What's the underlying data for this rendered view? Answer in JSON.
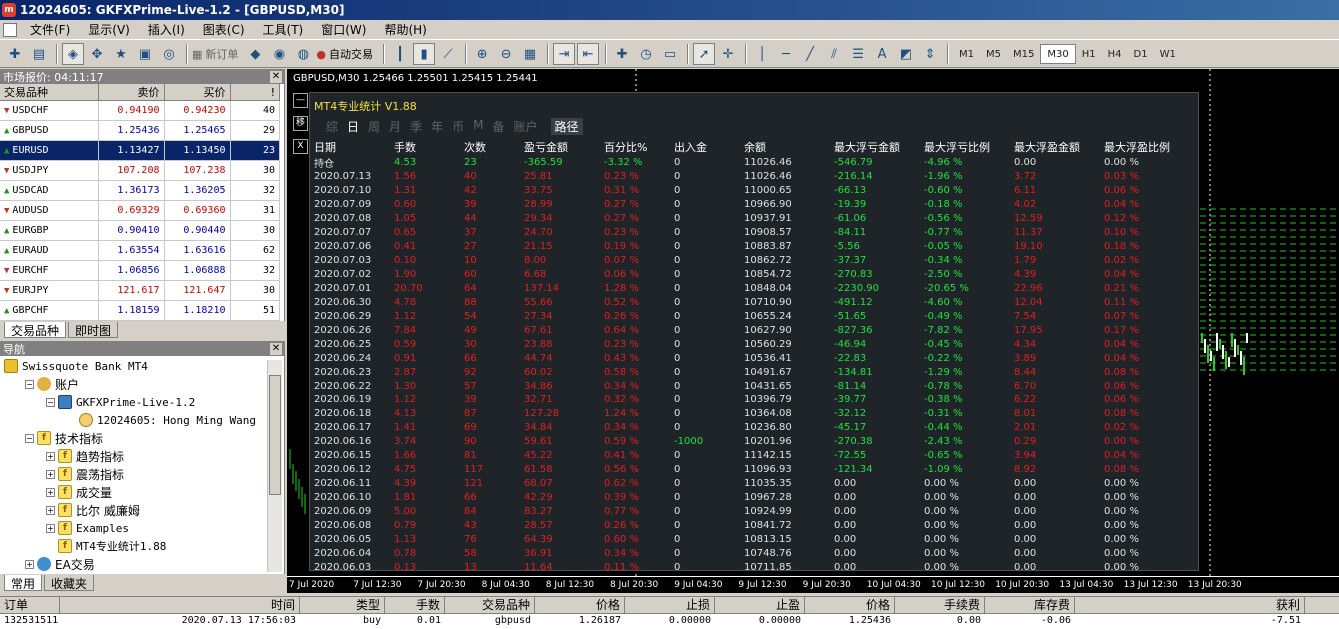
{
  "window": {
    "title": "12024605: GKFXPrime-Live-1.2 - [GBPUSD,M30]"
  },
  "menu": [
    "文件(F)",
    "显示(V)",
    "插入(I)",
    "图表(C)",
    "工具(T)",
    "窗口(W)",
    "帮助(H)"
  ],
  "toolbar": {
    "new_order_label": "新订单",
    "auto_trade_label": "自动交易",
    "timeframes": [
      "M1",
      "M5",
      "M15",
      "M30",
      "H1",
      "H4",
      "D1",
      "W1"
    ],
    "active_timeframe": "M30"
  },
  "market_watch": {
    "title": "市场报价: 04:11:17",
    "columns": [
      "交易品种",
      "卖价",
      "买价",
      "!"
    ],
    "rows": [
      {
        "symbol": "USDCHF",
        "bid": "0.94190",
        "ask": "0.94230",
        "spread": "40",
        "dir": "down",
        "color": "red"
      },
      {
        "symbol": "GBPUSD",
        "bid": "1.25436",
        "ask": "1.25465",
        "spread": "29",
        "dir": "up",
        "color": "blue"
      },
      {
        "symbol": "EURUSD",
        "bid": "1.13427",
        "ask": "1.13450",
        "spread": "23",
        "dir": "up",
        "color": "blue",
        "selected": true
      },
      {
        "symbol": "USDJPY",
        "bid": "107.208",
        "ask": "107.238",
        "spread": "30",
        "dir": "down",
        "color": "red"
      },
      {
        "symbol": "USDCAD",
        "bid": "1.36173",
        "ask": "1.36205",
        "spread": "32",
        "dir": "up",
        "color": "blue"
      },
      {
        "symbol": "AUDUSD",
        "bid": "0.69329",
        "ask": "0.69360",
        "spread": "31",
        "dir": "down",
        "color": "red"
      },
      {
        "symbol": "EURGBP",
        "bid": "0.90410",
        "ask": "0.90440",
        "spread": "30",
        "dir": "up",
        "color": "blue"
      },
      {
        "symbol": "EURAUD",
        "bid": "1.63554",
        "ask": "1.63616",
        "spread": "62",
        "dir": "up",
        "color": "blue"
      },
      {
        "symbol": "EURCHF",
        "bid": "1.06856",
        "ask": "1.06888",
        "spread": "32",
        "dir": "down",
        "color": "blue"
      },
      {
        "symbol": "EURJPY",
        "bid": "121.617",
        "ask": "121.647",
        "spread": "30",
        "dir": "down",
        "color": "red"
      },
      {
        "symbol": "GBPCHF",
        "bid": "1.18159",
        "ask": "1.18210",
        "spread": "51",
        "dir": "up",
        "color": "blue"
      }
    ],
    "tabs": [
      "交易品种",
      "即时图"
    ]
  },
  "navigator": {
    "title": "导航",
    "items": [
      {
        "label": "Swissquote Bank MT4",
        "level": 0,
        "icon": "folder",
        "mono": true
      },
      {
        "label": "账户",
        "level": 1,
        "icon": "acct",
        "expand": "-"
      },
      {
        "label": "GKFXPrime-Live-1.2",
        "level": 2,
        "icon": "server",
        "expand": "-",
        "mono": true
      },
      {
        "label": "12024605: Hong Ming  Wang",
        "level": 3,
        "icon": "user",
        "mono": true
      },
      {
        "label": "技术指标",
        "level": 1,
        "icon": "ind",
        "expand": "-"
      },
      {
        "label": "趋势指标",
        "level": 2,
        "icon": "ind",
        "expand": "+"
      },
      {
        "label": "震荡指标",
        "level": 2,
        "icon": "ind",
        "expand": "+"
      },
      {
        "label": "成交量",
        "level": 2,
        "icon": "ind",
        "expand": "+"
      },
      {
        "label": "比尔 威廉姆",
        "level": 2,
        "icon": "ind",
        "expand": "+"
      },
      {
        "label": "Examples",
        "level": 2,
        "icon": "ind",
        "expand": "+",
        "mono": true
      },
      {
        "label": "MT4专业统计1.88",
        "level": 2,
        "icon": "ind",
        "mono": true
      },
      {
        "label": "EA交易",
        "level": 1,
        "icon": "ea",
        "expand": "+"
      }
    ],
    "tabs": [
      "常用",
      "收藏夹"
    ]
  },
  "chart": {
    "info": "GBPUSD,M30  1.25466 1.25501 1.25415 1.25441",
    "time_labels": [
      "7 Jul 2020",
      "7 Jul 12:30",
      "7 Jul 20:30",
      "8 Jul 04:30",
      "8 Jul 12:30",
      "8 Jul 20:30",
      "9 Jul 04:30",
      "9 Jul 12:30",
      "9 Jul 20:30",
      "10 Jul 04:30",
      "10 Jul 12:30",
      "10 Jul 20:30",
      "13 Jul 04:30",
      "13 Jul 12:30",
      "13 Jul 20:30"
    ]
  },
  "stats": {
    "title": "MT4专业统计 V1.88",
    "side_buttons": [
      "—",
      "移",
      "X"
    ],
    "tabs": [
      "综",
      "日",
      "周",
      "月",
      "季",
      "年",
      "币",
      "M",
      "备",
      "账户"
    ],
    "active_tab": "日",
    "path_tab": "路径",
    "columns": [
      "日期",
      "手数",
      "次数",
      "盈亏金额",
      "百分比%",
      "出入金",
      "余额",
      "最大浮亏金额",
      "最大浮亏比例",
      "最大浮盈金额",
      "最大浮盈比例"
    ],
    "holding_row": {
      "date": "持仓",
      "lots": "4.53",
      "count": "23",
      "pnl": "-365.59",
      "pct": "-3.32 %",
      "flow": "0",
      "balance": "11026.46",
      "mdd": "-546.79",
      "mddp": "-4.96 %",
      "mfe": "0.00",
      "mfep": "0.00 %"
    },
    "rows": [
      {
        "date": "2020.07.13",
        "lots": "1.56",
        "count": "40",
        "pnl": "25.81",
        "pct": "0.23 %",
        "flow": "0",
        "balance": "11026.46",
        "mdd": "-216.14",
        "mddp": "-1.96 %",
        "mfe": "3.72",
        "mfep": "0.03 %"
      },
      {
        "date": "2020.07.10",
        "lots": "1.31",
        "count": "42",
        "pnl": "33.75",
        "pct": "0.31 %",
        "flow": "0",
        "balance": "11000.65",
        "mdd": "-66.13",
        "mddp": "-0.60 %",
        "mfe": "6.11",
        "mfep": "0.06 %"
      },
      {
        "date": "2020.07.09",
        "lots": "0.60",
        "count": "39",
        "pnl": "28.99",
        "pct": "0.27 %",
        "flow": "0",
        "balance": "10966.90",
        "mdd": "-19.39",
        "mddp": "-0.18 %",
        "mfe": "4.02",
        "mfep": "0.04 %"
      },
      {
        "date": "2020.07.08",
        "lots": "1.05",
        "count": "44",
        "pnl": "29.34",
        "pct": "0.27 %",
        "flow": "0",
        "balance": "10937.91",
        "mdd": "-61.06",
        "mddp": "-0.56 %",
        "mfe": "12.59",
        "mfep": "0.12 %"
      },
      {
        "date": "2020.07.07",
        "lots": "0.65",
        "count": "37",
        "pnl": "24.70",
        "pct": "0.23 %",
        "flow": "0",
        "balance": "10908.57",
        "mdd": "-84.11",
        "mddp": "-0.77 %",
        "mfe": "11.37",
        "mfep": "0.10 %"
      },
      {
        "date": "2020.07.06",
        "lots": "0.41",
        "count": "27",
        "pnl": "21.15",
        "pct": "0.19 %",
        "flow": "0",
        "balance": "10883.87",
        "mdd": "-5.56",
        "mddp": "-0.05 %",
        "mfe": "19.10",
        "mfep": "0.18 %"
      },
      {
        "date": "2020.07.03",
        "lots": "0.10",
        "count": "10",
        "pnl": "8.00",
        "pct": "0.07 %",
        "flow": "0",
        "balance": "10862.72",
        "mdd": "-37.37",
        "mddp": "-0.34 %",
        "mfe": "1.79",
        "mfep": "0.02 %"
      },
      {
        "date": "2020.07.02",
        "lots": "1.90",
        "count": "60",
        "pnl": "6.68",
        "pct": "0.06 %",
        "flow": "0",
        "balance": "10854.72",
        "mdd": "-270.83",
        "mddp": "-2.50 %",
        "mfe": "4.39",
        "mfep": "0.04 %"
      },
      {
        "date": "2020.07.01",
        "lots": "20.70",
        "count": "64",
        "pnl": "137.14",
        "pct": "1.28 %",
        "flow": "0",
        "balance": "10848.04",
        "mdd": "-2230.90",
        "mddp": "-20.65 %",
        "mfe": "22.96",
        "mfep": "0.21 %"
      },
      {
        "date": "2020.06.30",
        "lots": "4.78",
        "count": "88",
        "pnl": "55.66",
        "pct": "0.52 %",
        "flow": "0",
        "balance": "10710.90",
        "mdd": "-491.12",
        "mddp": "-4.60 %",
        "mfe": "12.04",
        "mfep": "0.11 %"
      },
      {
        "date": "2020.06.29",
        "lots": "1.12",
        "count": "54",
        "pnl": "27.34",
        "pct": "0.26 %",
        "flow": "0",
        "balance": "10655.24",
        "mdd": "-51.65",
        "mddp": "-0.49 %",
        "mfe": "7.54",
        "mfep": "0.07 %"
      },
      {
        "date": "2020.06.26",
        "lots": "7.84",
        "count": "49",
        "pnl": "67.61",
        "pct": "0.64 %",
        "flow": "0",
        "balance": "10627.90",
        "mdd": "-827.36",
        "mddp": "-7.82 %",
        "mfe": "17.95",
        "mfep": "0.17 %"
      },
      {
        "date": "2020.06.25",
        "lots": "0.59",
        "count": "30",
        "pnl": "23.88",
        "pct": "0.23 %",
        "flow": "0",
        "balance": "10560.29",
        "mdd": "-46.94",
        "mddp": "-0.45 %",
        "mfe": "4.34",
        "mfep": "0.04 %"
      },
      {
        "date": "2020.06.24",
        "lots": "0.91",
        "count": "66",
        "pnl": "44.74",
        "pct": "0.43 %",
        "flow": "0",
        "balance": "10536.41",
        "mdd": "-22.83",
        "mddp": "-0.22 %",
        "mfe": "3.89",
        "mfep": "0.04 %"
      },
      {
        "date": "2020.06.23",
        "lots": "2.87",
        "count": "92",
        "pnl": "60.02",
        "pct": "0.58 %",
        "flow": "0",
        "balance": "10491.67",
        "mdd": "-134.81",
        "mddp": "-1.29 %",
        "mfe": "8.44",
        "mfep": "0.08 %"
      },
      {
        "date": "2020.06.22",
        "lots": "1.30",
        "count": "57",
        "pnl": "34.86",
        "pct": "0.34 %",
        "flow": "0",
        "balance": "10431.65",
        "mdd": "-81.14",
        "mddp": "-0.78 %",
        "mfe": "6.70",
        "mfep": "0.06 %"
      },
      {
        "date": "2020.06.19",
        "lots": "1.12",
        "count": "39",
        "pnl": "32.71",
        "pct": "0.32 %",
        "flow": "0",
        "balance": "10396.79",
        "mdd": "-39.77",
        "mddp": "-0.38 %",
        "mfe": "6.22",
        "mfep": "0.06 %"
      },
      {
        "date": "2020.06.18",
        "lots": "4.13",
        "count": "87",
        "pnl": "127.28",
        "pct": "1.24 %",
        "flow": "0",
        "balance": "10364.08",
        "mdd": "-32.12",
        "mddp": "-0.31 %",
        "mfe": "8.01",
        "mfep": "0.08 %"
      },
      {
        "date": "2020.06.17",
        "lots": "1.41",
        "count": "69",
        "pnl": "34.84",
        "pct": "0.34 %",
        "flow": "0",
        "balance": "10236.80",
        "mdd": "-45.17",
        "mddp": "-0.44 %",
        "mfe": "2.01",
        "mfep": "0.02 %"
      },
      {
        "date": "2020.06.16",
        "lots": "3.74",
        "count": "90",
        "pnl": "59.61",
        "pct": "0.59 %",
        "flow": "-1000",
        "balance": "10201.96",
        "mdd": "-270.38",
        "mddp": "-2.43 %",
        "mfe": "0.29",
        "mfep": "0.00 %"
      },
      {
        "date": "2020.06.15",
        "lots": "1.66",
        "count": "81",
        "pnl": "45.22",
        "pct": "0.41 %",
        "flow": "0",
        "balance": "11142.15",
        "mdd": "-72.55",
        "mddp": "-0.65 %",
        "mfe": "3.94",
        "mfep": "0.04 %"
      },
      {
        "date": "2020.06.12",
        "lots": "4.75",
        "count": "117",
        "pnl": "61.58",
        "pct": "0.56 %",
        "flow": "0",
        "balance": "11096.93",
        "mdd": "-121.34",
        "mddp": "-1.09 %",
        "mfe": "8.92",
        "mfep": "0.08 %"
      },
      {
        "date": "2020.06.11",
        "lots": "4.39",
        "count": "121",
        "pnl": "68.07",
        "pct": "0.62 %",
        "flow": "0",
        "balance": "11035.35",
        "mdd": "0.00",
        "mddp": "0.00 %",
        "mfe": "0.00",
        "mfep": "0.00 %"
      },
      {
        "date": "2020.06.10",
        "lots": "1.81",
        "count": "66",
        "pnl": "42.29",
        "pct": "0.39 %",
        "flow": "0",
        "balance": "10967.28",
        "mdd": "0.00",
        "mddp": "0.00 %",
        "mfe": "0.00",
        "mfep": "0.00 %"
      },
      {
        "date": "2020.06.09",
        "lots": "5.00",
        "count": "84",
        "pnl": "83.27",
        "pct": "0.77 %",
        "flow": "0",
        "balance": "10924.99",
        "mdd": "0.00",
        "mddp": "0.00 %",
        "mfe": "0.00",
        "mfep": "0.00 %"
      },
      {
        "date": "2020.06.08",
        "lots": "0.79",
        "count": "43",
        "pnl": "28.57",
        "pct": "0.26 %",
        "flow": "0",
        "balance": "10841.72",
        "mdd": "0.00",
        "mddp": "0.00 %",
        "mfe": "0.00",
        "mfep": "0.00 %"
      },
      {
        "date": "2020.06.05",
        "lots": "1.13",
        "count": "76",
        "pnl": "64.39",
        "pct": "0.60 %",
        "flow": "0",
        "balance": "10813.15",
        "mdd": "0.00",
        "mddp": "0.00 %",
        "mfe": "0.00",
        "mfep": "0.00 %"
      },
      {
        "date": "2020.06.04",
        "lots": "0.78",
        "count": "58",
        "pnl": "36.91",
        "pct": "0.34 %",
        "flow": "0",
        "balance": "10748.76",
        "mdd": "0.00",
        "mddp": "0.00 %",
        "mfe": "0.00",
        "mfep": "0.00 %"
      },
      {
        "date": "2020.06.03",
        "lots": "0.13",
        "count": "13",
        "pnl": "11.64",
        "pct": "0.11 %",
        "flow": "0",
        "balance": "10711.85",
        "mdd": "0.00",
        "mddp": "0.00 %",
        "mfe": "0.00",
        "mfep": "0.00 %"
      }
    ]
  },
  "terminal": {
    "columns": [
      "订单",
      "时间",
      "类型",
      "手数",
      "交易品种",
      "价格",
      "止损",
      "止盈",
      "价格",
      "手续费",
      "库存费",
      "获利"
    ],
    "row": [
      "132531511",
      "2020.07.13 17:56:03",
      "buy",
      "0.01",
      "gbpusd",
      "1.26187",
      "0.00000",
      "0.00000",
      "1.25436",
      "0.00",
      "-0.06",
      "-7.51"
    ]
  }
}
